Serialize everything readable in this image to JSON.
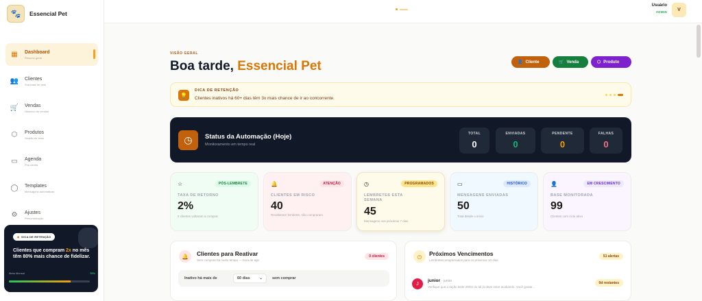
{
  "sidebar": {
    "brand": "Essencial Pet",
    "items": [
      {
        "label": "Dashboard",
        "sub": "Resumo geral"
      },
      {
        "label": "Clientes",
        "sub": "Sua base de pets"
      },
      {
        "label": "Vendas",
        "sub": "Histórico de vendas"
      },
      {
        "label": "Produtos",
        "sub": "Gestão de itens"
      },
      {
        "label": "Agenda",
        "sub": "Pós-venda"
      },
      {
        "label": "Templates",
        "sub": "Mensagens automáticas"
      },
      {
        "label": "Ajustes",
        "sub": "Personalização"
      }
    ],
    "tip": {
      "badge": "DICA DE RETENÇÃO",
      "text_before": "Clientes que compram ",
      "highlight": "2x",
      "text_after": " no mês têm 80% mais chance de fidelizar.",
      "meta_label": "Meta Mensal",
      "meta_value": "76%",
      "progress": 0.76
    }
  },
  "topbar": {
    "user_name": "Usuário",
    "user_role": "ADMIN",
    "avatar_initial": "V"
  },
  "header": {
    "eyebrow": "VISÃO GERAL",
    "greeting": "Boa tarde, ",
    "name": "Essencial Pet",
    "actions": {
      "cliente": "Cliente",
      "venda": "Venda",
      "produto": "Produto"
    }
  },
  "tip_banner": {
    "title": "DICA DE RETENÇÃO",
    "text": "Clientes inativos há 60+ dias têm 3x mais chance de ir ao concorrente."
  },
  "automation": {
    "title": "Status da Automação (Hoje)",
    "subtitle": "Monitoramento em tempo real",
    "stats": [
      {
        "label": "TOTAL",
        "value": "0",
        "color": "#ffffff"
      },
      {
        "label": "ENVIADAS",
        "value": "0",
        "color": "#10b981"
      },
      {
        "label": "PENDENTE",
        "value": "0",
        "color": "#f59e0b"
      },
      {
        "label": "FALHAS",
        "value": "0",
        "color": "#fb7185"
      }
    ]
  },
  "cards": [
    {
      "icon": "star-icon",
      "badge": "PÓS-LEMBRETE",
      "label": "TAXA DE RETORNO",
      "value": "2%",
      "note": "2 clientes voltaram a comprar"
    },
    {
      "icon": "bell-icon",
      "badge": "ATENÇÃO",
      "label": "CLIENTES EM RISCO",
      "value": "40",
      "note": "Receberam lembrete, não compraram"
    },
    {
      "icon": "clock-icon",
      "badge": "PROGRAMADOS",
      "label": "LEMBRETES ESTA SEMANA",
      "value": "45",
      "note": "Mensagens nos próximos 7 dias"
    },
    {
      "icon": "message-icon",
      "badge": "HISTÓRICO",
      "label": "MENSAGENS ENVIADAS",
      "value": "50",
      "note": "Total desde o início"
    },
    {
      "icon": "user-plus-icon",
      "badge": "EM CRESCIMENTO",
      "label": "BASE MONITORADA",
      "value": "99",
      "note": "Clientes com ciclo ativo"
    }
  ],
  "reactivate": {
    "title": "Clientes para Reativar",
    "subtitle": "Sem compras há muito tempo — hora de agir",
    "badge": "0 clientes",
    "filter_prefix": "Inativo há mais de",
    "filter_value": "60 dias",
    "filter_suffix": "sem comprar"
  },
  "upcoming": {
    "title": "Próximos Vencimentos",
    "subtitle": "Lembretes programados para os próximos 10 dias",
    "badge": "51 alertas",
    "row": {
      "initial": "J",
      "name": "junior",
      "tag": "· junior",
      "text": "Verifique que a ração teste 20/02 do tal já deve estar acabando. Você gostar...",
      "badge": "0d restantes"
    }
  }
}
